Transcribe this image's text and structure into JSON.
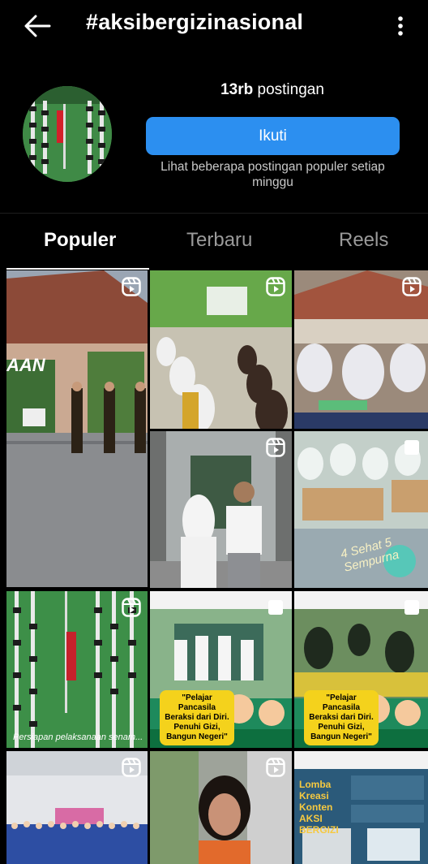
{
  "header": {
    "title": "#aksibergizinasional"
  },
  "profile": {
    "post_count_number": "13rb",
    "post_count_label": "postingan",
    "follow_label": "Ikuti",
    "subtext": "Lihat beberapa postingan populer setiap minggu"
  },
  "tabs": [
    {
      "label": "Populer",
      "active": true
    },
    {
      "label": "Terbaru",
      "active": false
    },
    {
      "label": "Reels",
      "active": false
    }
  ],
  "grid": {
    "tiles": [
      {
        "badge": "reel-icon",
        "overlay_text": "AAN"
      },
      {
        "badge": "reel-icon"
      },
      {
        "badge": "reel-icon"
      },
      {
        "badge": "reel-icon"
      },
      {
        "badge": "multi-post-icon",
        "overlay_text": "4 Sehat 5 Sempurna"
      },
      {
        "badge": "reel-icon",
        "overlay_text": "Persiapan pelaksanaan senam..."
      },
      {
        "badge": "multi-post-icon",
        "overlay_text": "\"Pelajar Pancasila Beraksi dari Diri. Penuhi Gizi, Bangun Negeri\""
      },
      {
        "badge": "multi-post-icon",
        "overlay_text": "\"Pelajar Pancasila Beraksi dari Diri. Penuhi Gizi, Bangun Negeri\""
      },
      {
        "badge": "reel-icon"
      },
      {
        "badge": "reel-icon"
      },
      {
        "badge": "none",
        "overlay_text": "Lomba Kreasi Konten AKSI BERGIZI"
      }
    ]
  },
  "colors": {
    "background": "#000000",
    "follow_button": "#2c8ff0",
    "subtext": "#c9c9c9",
    "inactive_tab": "#9a9a9a"
  }
}
